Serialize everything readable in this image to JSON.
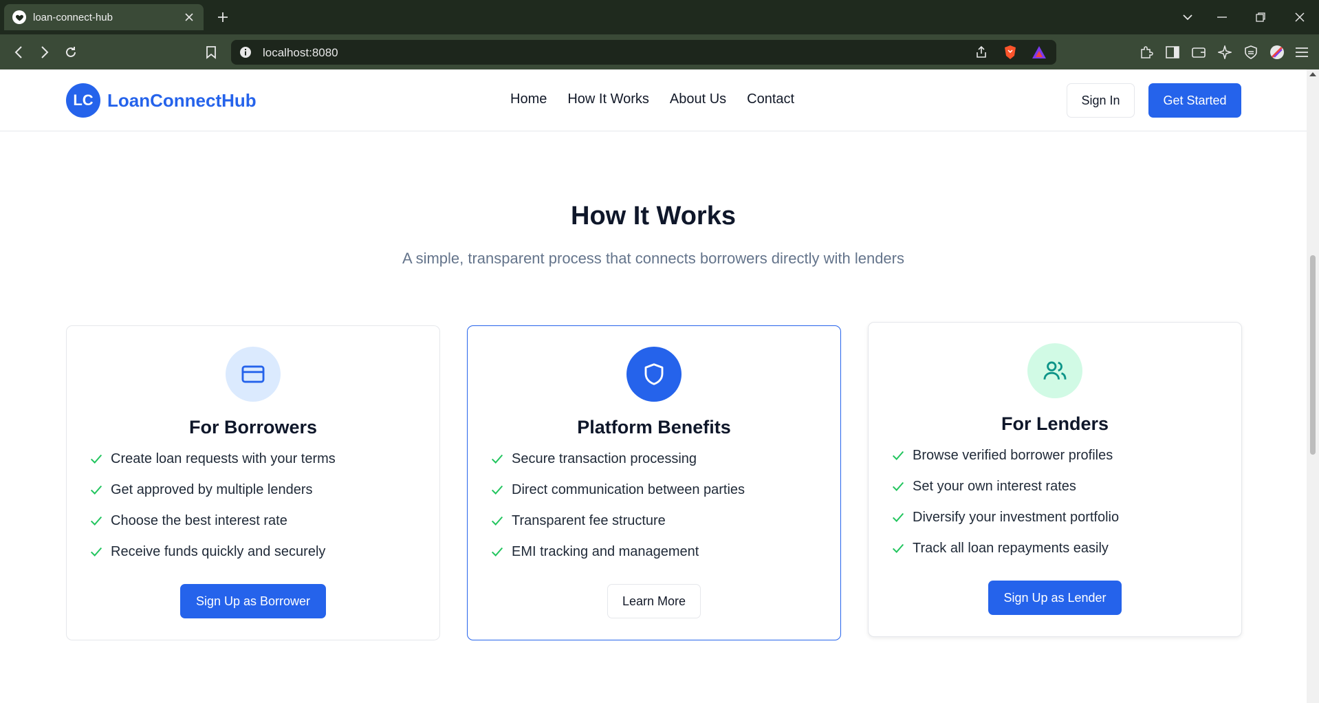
{
  "browser": {
    "tab_title": "loan-connect-hub",
    "url": "localhost:8080"
  },
  "nav": {
    "logo_initials": "LC",
    "brand": "LoanConnectHub",
    "links": [
      "Home",
      "How It Works",
      "About Us",
      "Contact"
    ],
    "sign_in": "Sign In",
    "get_started": "Get Started"
  },
  "section": {
    "title": "How It Works",
    "subtitle": "A simple, transparent process that connects borrowers directly with lenders"
  },
  "cards": [
    {
      "title": "For Borrowers",
      "icon": "credit-card-icon",
      "features": [
        "Create loan requests with your terms",
        "Get approved by multiple lenders",
        "Choose the best interest rate",
        "Receive funds quickly and securely"
      ],
      "button": "Sign Up as Borrower"
    },
    {
      "title": "Platform Benefits",
      "icon": "shield-icon",
      "features": [
        "Secure transaction processing",
        "Direct communication between parties",
        "Transparent fee structure",
        "EMI tracking and management"
      ],
      "button": "Learn More"
    },
    {
      "title": "For Lenders",
      "icon": "users-icon",
      "features": [
        "Browse verified borrower profiles",
        "Set your own interest rates",
        "Diversify your investment portfolio",
        "Track all loan repayments easily"
      ],
      "button": "Sign Up as Lender"
    }
  ],
  "colors": {
    "primary": "#2563eb",
    "check": "#22c55e",
    "lender_icon_bg": "#d1fae5",
    "lender_icon": "#0d9488",
    "borrower_icon_bg": "#dbeafe"
  }
}
